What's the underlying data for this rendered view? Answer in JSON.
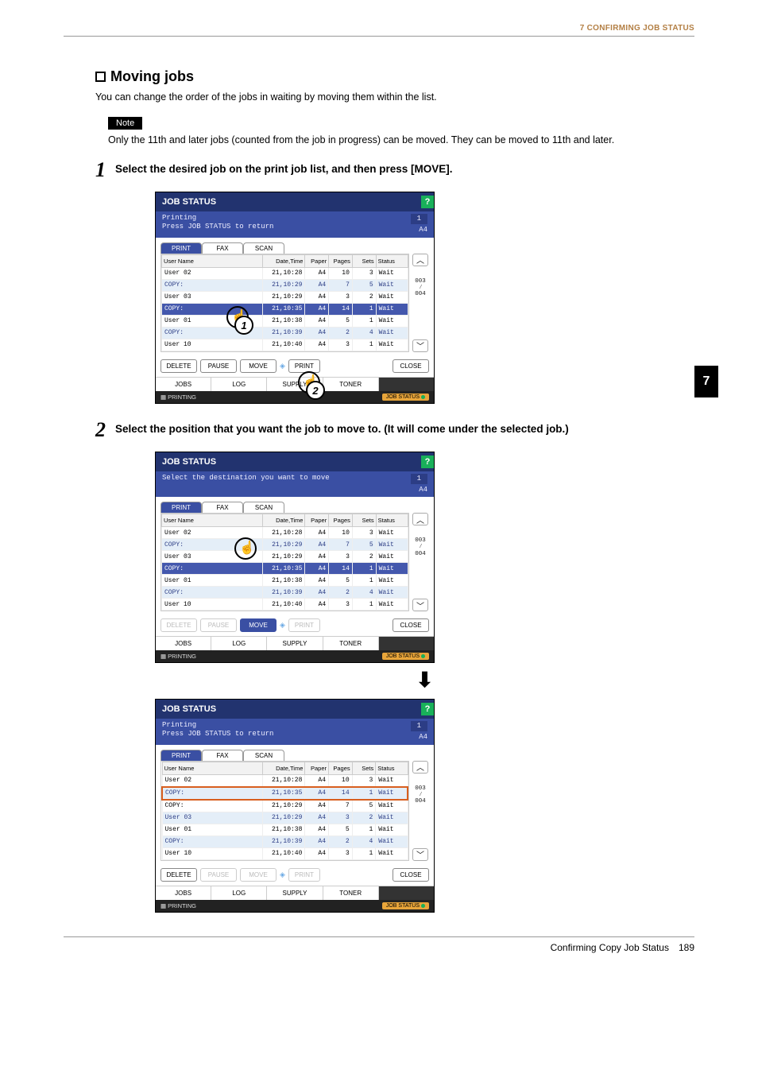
{
  "header": {
    "running_head": "7 CONFIRMING JOB STATUS"
  },
  "section": {
    "title": "Moving jobs",
    "intro": "You can change the order of the jobs in waiting by moving them within the list.",
    "note_label": "Note",
    "note_text": "Only the 11th and later jobs (counted from the job in progress) can be moved. They can be moved to 11th and later."
  },
  "steps": {
    "s1": {
      "num": "1",
      "text": "Select the desired job on the print job list, and then press [MOVE]."
    },
    "s2": {
      "num": "2",
      "text": "Select the position that you want the job to move to. (It will come under the selected job.)"
    }
  },
  "side_tab": "7",
  "panel_common": {
    "title": "JOB STATUS",
    "help": "?",
    "counter": "1",
    "a4": "A4",
    "tabs": {
      "print": "PRINT",
      "fax": "FAX",
      "scan": "SCAN"
    },
    "th": {
      "user": "User Name",
      "dt": "Date,Time",
      "paper": "Paper",
      "pages": "Pages",
      "sets": "Sets",
      "status": "Status"
    },
    "scroll": {
      "cur": "003",
      "sep": "⁄",
      "tot": "004"
    },
    "buttons": {
      "delete": "DELETE",
      "pause": "PAUSE",
      "move": "MOVE",
      "print": "PRINT",
      "close": "CLOSE"
    },
    "btabs": {
      "jobs": "JOBS",
      "log": "LOG",
      "supply": "SUPPLY",
      "toner": "TONER"
    },
    "footer": {
      "printing": "PRINTING",
      "jobstatus": "JOB STATUS"
    }
  },
  "panel1": {
    "sub1": "Printing",
    "sub2": "Press JOB STATUS to return",
    "rows": [
      {
        "user": "User 02",
        "dt": "21,10:28",
        "paper": "A4",
        "pages": "10",
        "sets": "3",
        "status": "Wait",
        "cls": ""
      },
      {
        "user": "COPY:",
        "dt": "21,10:29",
        "paper": "A4",
        "pages": "7",
        "sets": "5",
        "status": "Wait",
        "cls": "alt"
      },
      {
        "user": "User 03",
        "dt": "21,10:29",
        "paper": "A4",
        "pages": "3",
        "sets": "2",
        "status": "Wait",
        "cls": ""
      },
      {
        "user": "COPY:",
        "dt": "21,10:35",
        "paper": "A4",
        "pages": "14",
        "sets": "1",
        "status": "Wait",
        "cls": "sel"
      },
      {
        "user": "User 01",
        "dt": "21,10:38",
        "paper": "A4",
        "pages": "5",
        "sets": "1",
        "status": "Wait",
        "cls": ""
      },
      {
        "user": "COPY:",
        "dt": "21,10:39",
        "paper": "A4",
        "pages": "2",
        "sets": "4",
        "status": "Wait",
        "cls": "alt"
      },
      {
        "user": "User 10",
        "dt": "21,10:40",
        "paper": "A4",
        "pages": "3",
        "sets": "1",
        "status": "Wait",
        "cls": ""
      }
    ],
    "callout1": "1",
    "callout2": "2"
  },
  "panel2": {
    "sub1": "Select the destination you want to move",
    "rows": [
      {
        "user": "User 02",
        "dt": "21,10:28",
        "paper": "A4",
        "pages": "10",
        "sets": "3",
        "status": "Wait",
        "cls": ""
      },
      {
        "user": "COPY:",
        "dt": "21,10:29",
        "paper": "A4",
        "pages": "7",
        "sets": "5",
        "status": "Wait",
        "cls": "alt"
      },
      {
        "user": "User 03",
        "dt": "21,10:29",
        "paper": "A4",
        "pages": "3",
        "sets": "2",
        "status": "Wait",
        "cls": ""
      },
      {
        "user": "COPY:",
        "dt": "21,10:35",
        "paper": "A4",
        "pages": "14",
        "sets": "1",
        "status": "Wait",
        "cls": "sel"
      },
      {
        "user": "User 01",
        "dt": "21,10:38",
        "paper": "A4",
        "pages": "5",
        "sets": "1",
        "status": "Wait",
        "cls": ""
      },
      {
        "user": "COPY:",
        "dt": "21,10:39",
        "paper": "A4",
        "pages": "2",
        "sets": "4",
        "status": "Wait",
        "cls": "alt"
      },
      {
        "user": "User 10",
        "dt": "21,10:40",
        "paper": "A4",
        "pages": "3",
        "sets": "1",
        "status": "Wait",
        "cls": ""
      }
    ]
  },
  "panel3": {
    "sub1": "Printing",
    "sub2": "Press JOB STATUS to return",
    "rows": [
      {
        "user": "User 02",
        "dt": "21,10:28",
        "paper": "A4",
        "pages": "10",
        "sets": "3",
        "status": "Wait",
        "cls": ""
      },
      {
        "user": "COPY:",
        "dt": "21,10:35",
        "paper": "A4",
        "pages": "14",
        "sets": "1",
        "status": "Wait",
        "cls": "alt moved"
      },
      {
        "user": "COPY:",
        "dt": "21,10:29",
        "paper": "A4",
        "pages": "7",
        "sets": "5",
        "status": "Wait",
        "cls": ""
      },
      {
        "user": "User 03",
        "dt": "21,10:29",
        "paper": "A4",
        "pages": "3",
        "sets": "2",
        "status": "Wait",
        "cls": "alt"
      },
      {
        "user": "User 01",
        "dt": "21,10:38",
        "paper": "A4",
        "pages": "5",
        "sets": "1",
        "status": "Wait",
        "cls": ""
      },
      {
        "user": "COPY:",
        "dt": "21,10:39",
        "paper": "A4",
        "pages": "2",
        "sets": "4",
        "status": "Wait",
        "cls": "alt"
      },
      {
        "user": "User 10",
        "dt": "21,10:40",
        "paper": "A4",
        "pages": "3",
        "sets": "1",
        "status": "Wait",
        "cls": ""
      }
    ]
  },
  "footer": {
    "section": "Confirming Copy Job Status",
    "page": "189"
  }
}
